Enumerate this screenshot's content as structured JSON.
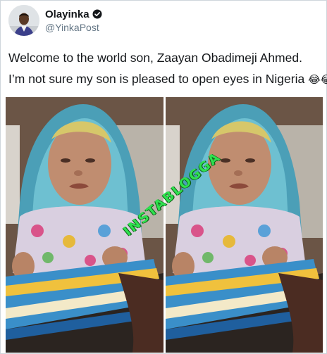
{
  "tweet": {
    "display_name": "Olayinka",
    "handle": "@YinkaPost",
    "verified": true,
    "avatar_icon": "profile-avatar",
    "verified_icon": "verified-badge-icon",
    "lines": [
      "Welcome to the world son, Zaayan Obadimeji Ahmed.",
      "I’m not sure my son is pleased to open eyes in Nigeria"
    ],
    "emoji": "😂😂"
  },
  "media": {
    "photos": [
      "left-baby-photo",
      "right-baby-photo"
    ],
    "watermark_text": "INSTABLOGGA",
    "watermark_color": "#2fe04f"
  }
}
